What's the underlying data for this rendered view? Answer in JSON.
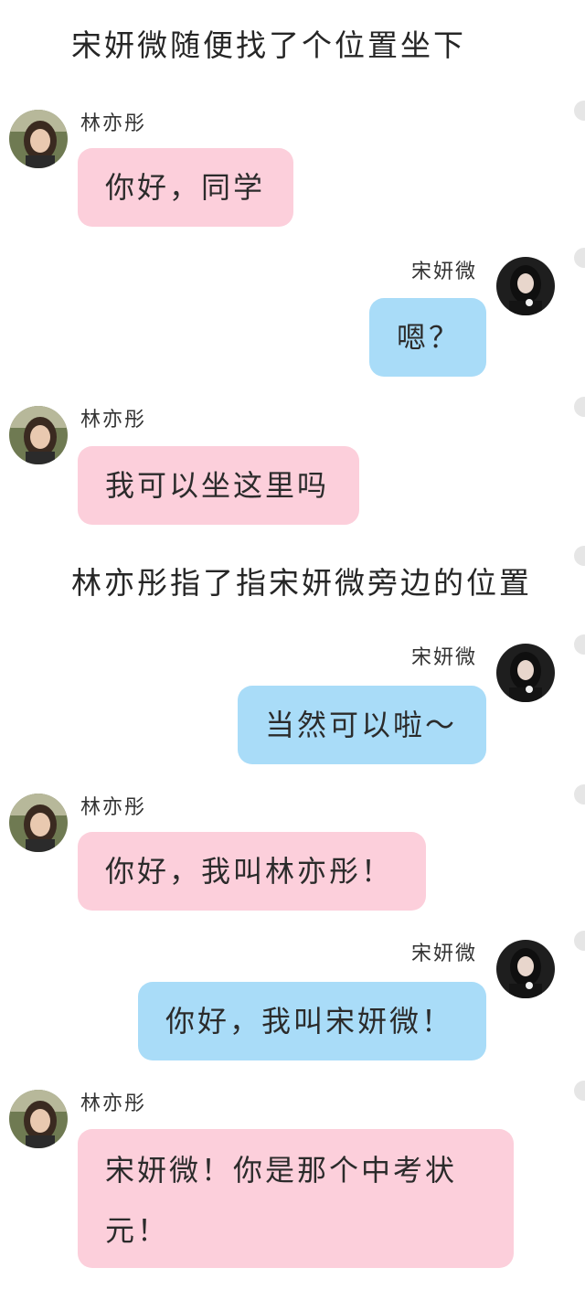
{
  "characters": {
    "lin": {
      "name": "林亦彤",
      "avatar_icon": "girl-portrait-avatar-icon",
      "bubble_color": "#fccfdb"
    },
    "song": {
      "name": "宋妍微",
      "avatar_icon": "dark-portrait-avatar-icon",
      "bubble_color": "#a9dcf8"
    }
  },
  "messages": [
    {
      "kind": "narration",
      "text": "宋妍微随便找了个位置坐下"
    },
    {
      "kind": "message",
      "speaker": "林亦彤",
      "side": "left",
      "text": "你好，同学"
    },
    {
      "kind": "message",
      "speaker": "宋妍微",
      "side": "right",
      "text": "嗯？"
    },
    {
      "kind": "message",
      "speaker": "林亦彤",
      "side": "left",
      "text": "我可以坐这里吗"
    },
    {
      "kind": "narration",
      "text": "林亦彤指了指宋妍微旁边的位置"
    },
    {
      "kind": "message",
      "speaker": "宋妍微",
      "side": "right",
      "text": "当然可以啦～"
    },
    {
      "kind": "message",
      "speaker": "林亦彤",
      "side": "left",
      "text": "你好，我叫林亦彤！"
    },
    {
      "kind": "message",
      "speaker": "宋妍微",
      "side": "right",
      "text": "你好，我叫宋妍微！"
    },
    {
      "kind": "message",
      "speaker": "林亦彤",
      "side": "left",
      "text": "宋妍微！你是那个中考状元！"
    }
  ]
}
